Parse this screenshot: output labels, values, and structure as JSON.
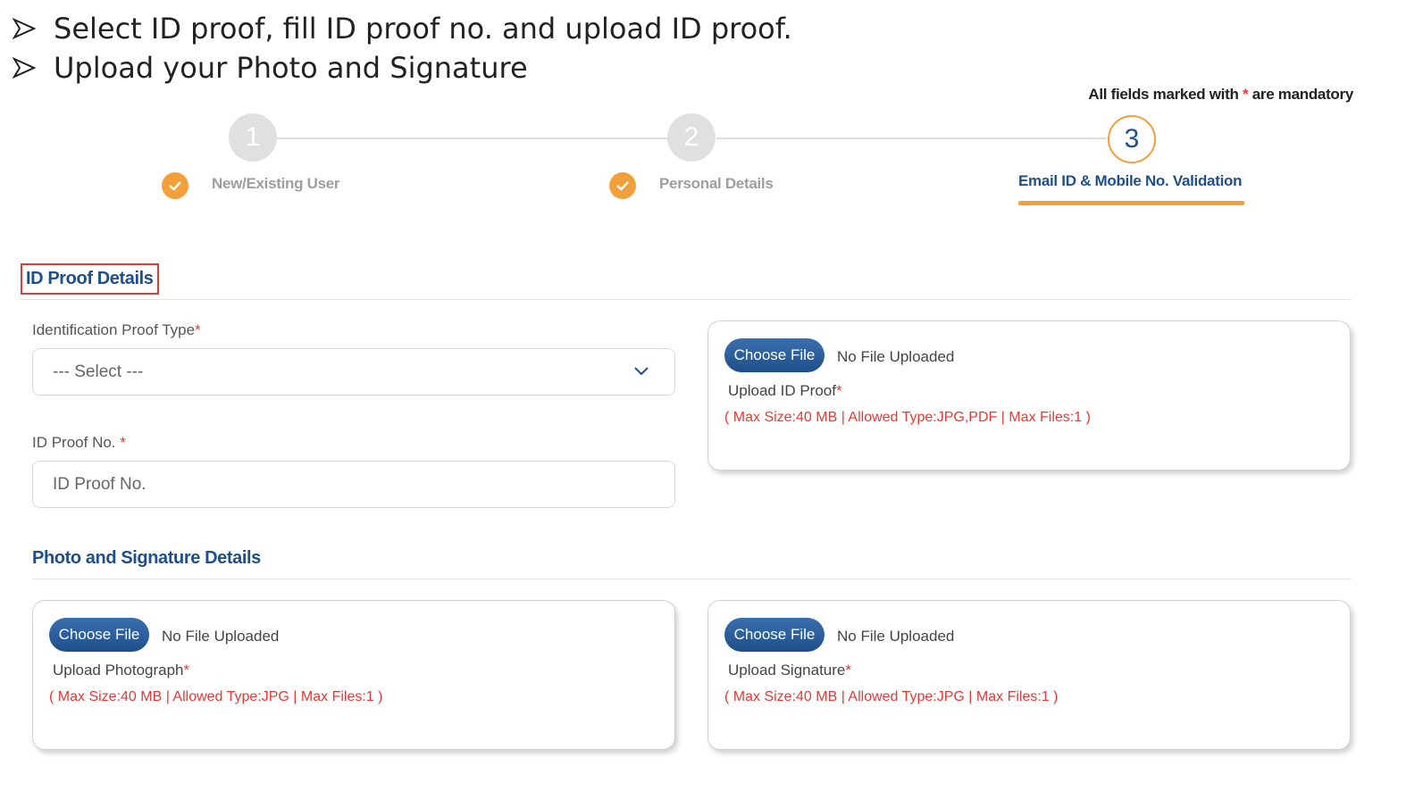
{
  "instructions": [
    "Select ID proof, fill ID proof no. and upload ID proof.",
    "Upload your Photo and Signature"
  ],
  "mandatory_note": {
    "prefix": "All fields marked with",
    "star": "*",
    "suffix": "are mandatory"
  },
  "stepper": {
    "steps": [
      {
        "number": "1",
        "label": "New/Existing User",
        "status": "completed"
      },
      {
        "number": "2",
        "label": "Personal Details",
        "status": "completed"
      },
      {
        "number": "3",
        "label": "Email ID & Mobile No. Validation",
        "status": "active"
      }
    ]
  },
  "id_proof_section": {
    "title": "ID Proof Details",
    "type_label": "Identification Proof Type",
    "type_value": "--- Select ---",
    "number_label": "ID Proof No.",
    "number_placeholder": "ID Proof No.",
    "upload": {
      "button": "Choose File",
      "status": "No File Uploaded",
      "label": "Upload ID Proof",
      "hint": "( Max Size:40 MB | Allowed Type:JPG,PDF | Max Files:1 )"
    }
  },
  "photo_section": {
    "title": "Photo and Signature Details",
    "photo_upload": {
      "button": "Choose File",
      "status": "No File Uploaded",
      "label": "Upload Photograph",
      "hint": "( Max Size:40 MB | Allowed Type:JPG | Max Files:1 )"
    },
    "signature_upload": {
      "button": "Choose File",
      "status": "No File Uploaded",
      "label": "Upload Signature",
      "hint": "( Max Size:40 MB | Allowed Type:JPG | Max Files:1 )"
    }
  },
  "required_star": "*",
  "colors": {
    "accent": "#f2a03b",
    "primary": "#1e4f8a",
    "error": "#e53935"
  }
}
